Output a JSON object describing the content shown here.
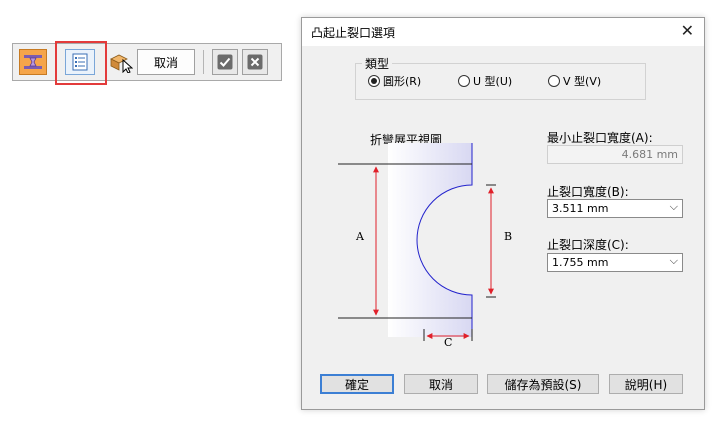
{
  "toolbar": {
    "cancel_label": "取消"
  },
  "dialog": {
    "title": "凸起止裂口選項",
    "type_group": {
      "label": "類型",
      "options": [
        {
          "label": "圓形(R)",
          "selected": true
        },
        {
          "label": "U 型(U)",
          "selected": false
        },
        {
          "label": "V 型(V)",
          "selected": false
        }
      ]
    },
    "diagram": {
      "title": "折彎展平視圖",
      "label_a": "A",
      "label_b": "B",
      "label_c": "C"
    },
    "fields": {
      "min_width": {
        "label": "最小止裂口寬度(A):",
        "value": "4.681 mm"
      },
      "relief_width": {
        "label": "止裂口寬度(B):",
        "value": "3.511 mm"
      },
      "relief_depth": {
        "label": "止裂口深度(C):",
        "value": "1.755 mm"
      }
    },
    "buttons": {
      "ok": "確定",
      "cancel": "取消",
      "save_default": "儲存為預設(S)",
      "help": "說明(H)"
    }
  },
  "colors": {
    "highlight": "#e33b3b",
    "dimension_red": "#e0202a",
    "outline_blue": "#2222cc",
    "shade": "#e3e3f4"
  }
}
